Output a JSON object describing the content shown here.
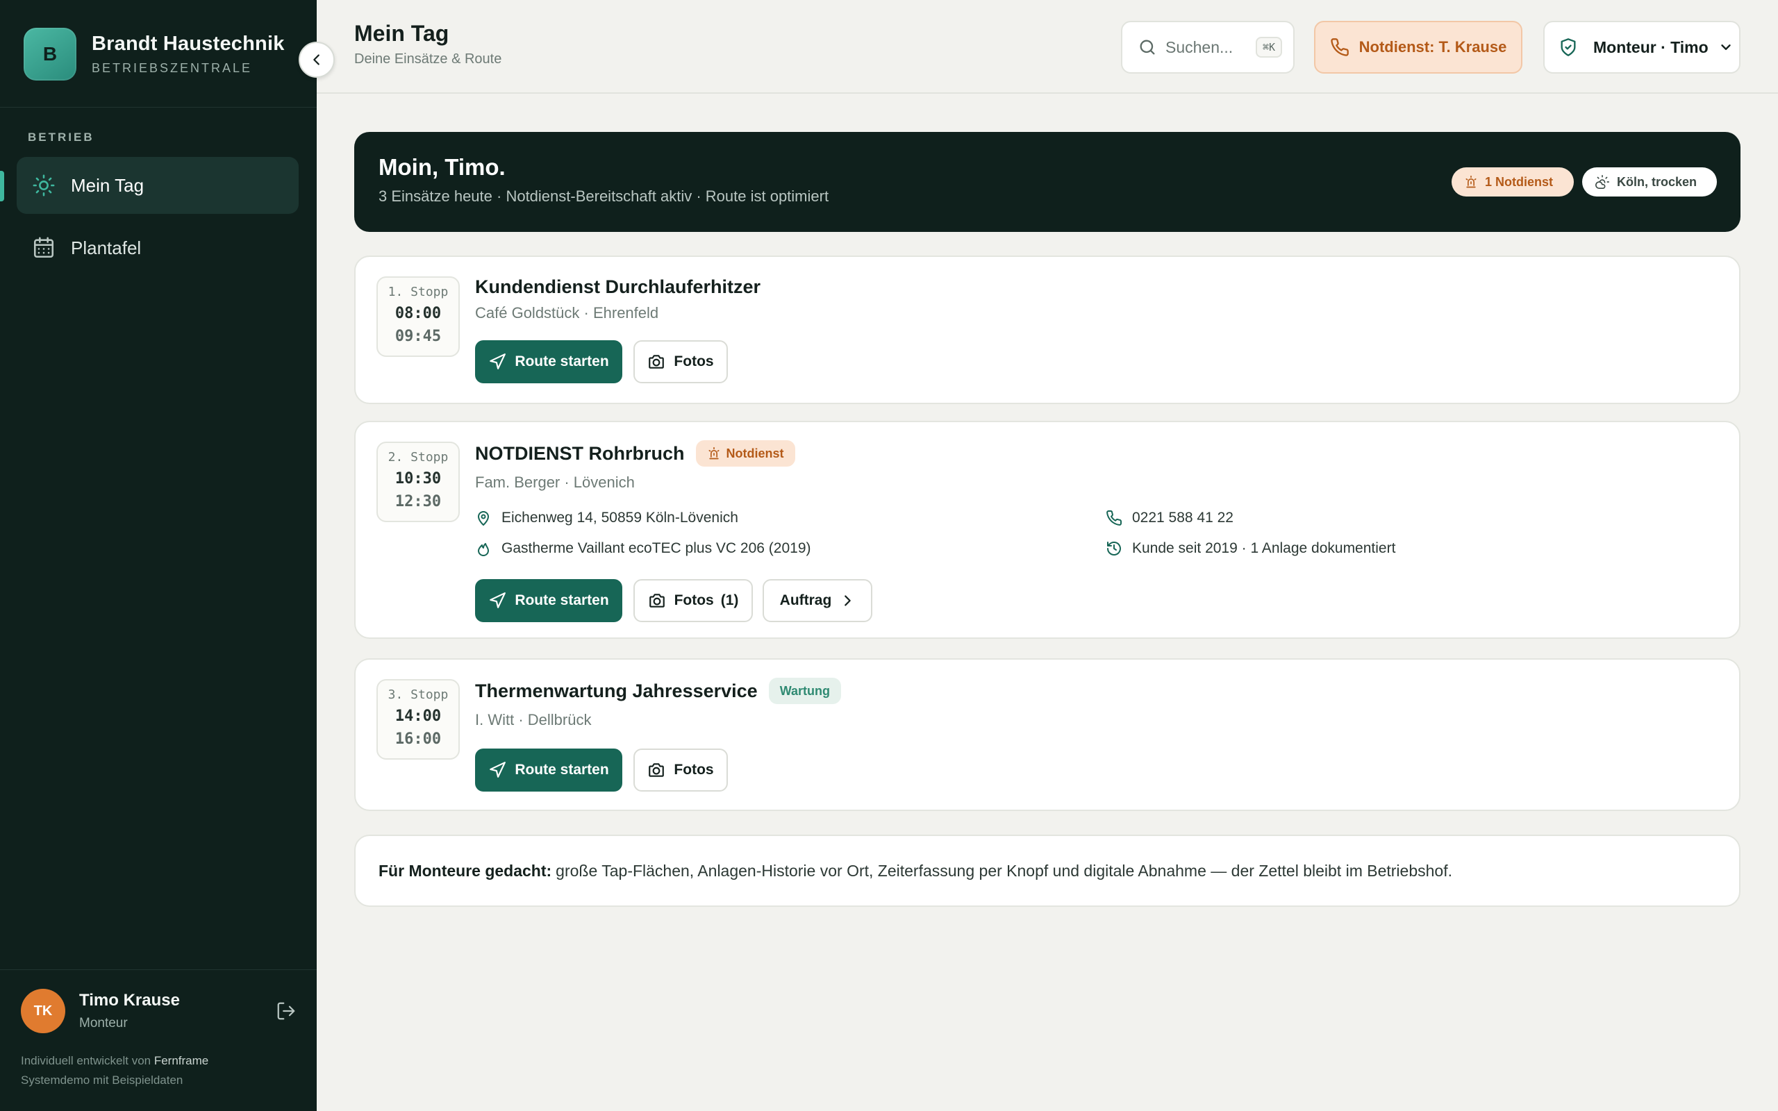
{
  "sidebar": {
    "brand_initial": "B",
    "brand_name": "Brandt Haustechnik",
    "brand_sub": "BETRIEBSZENTRALE",
    "section_label": "BETRIEB",
    "items": [
      {
        "label": "Mein Tag",
        "icon": "sun-icon",
        "active": true
      },
      {
        "label": "Plantafel",
        "icon": "calendar-icon",
        "active": false
      }
    ],
    "user": {
      "initials": "TK",
      "name": "Timo Krause",
      "role": "Monteur"
    },
    "credits_line1_prefix": "Individuell entwickelt von",
    "credits_line1_brand": "Fernframe",
    "credits_line2": "Systemdemo mit Beispieldaten"
  },
  "header": {
    "title": "Mein Tag",
    "subtitle": "Deine Einsätze & Route",
    "search_placeholder": "Suchen...",
    "search_shortcut": "⌘K",
    "notdienst_label": "Notdienst: T. Krause",
    "role_label": "Monteur · Timo"
  },
  "welcome": {
    "title": "Moin, Timo.",
    "subtitle": "3 Einsätze heute · Notdienst-Bereitschaft aktiv · Route ist optimiert",
    "pill_notdienst": "1 Notdienst",
    "pill_weather": "Köln, trocken"
  },
  "stops": [
    {
      "stop": "1. Stopp",
      "start": "08:00",
      "end": "09:45",
      "title": "Kundendienst Durchlauferhitzer",
      "sub": "Café Goldstück · Ehrenfeld",
      "route_label": "Route starten",
      "photos_label": "Fotos"
    },
    {
      "stop": "2. Stopp",
      "start": "10:30",
      "end": "12:30",
      "title": "NOTDIENST Rohrbruch",
      "badge": "Notdienst",
      "sub": "Fam. Berger · Lövenich",
      "address": "Eichenweg 14, 50859 Köln-Lövenich",
      "device": "Gastherme Vaillant ecoTEC plus VC 206 (2019)",
      "phone": "0221 588 41 22",
      "history": "Kunde seit 2019 · 1 Anlage dokumentiert",
      "route_label": "Route starten",
      "photos_label": "Fotos",
      "photos_count": "(1)",
      "auftrag_label": "Auftrag"
    },
    {
      "stop": "3. Stopp",
      "start": "14:00",
      "end": "16:00",
      "title": "Thermenwartung Jahresservice",
      "badge": "Wartung",
      "sub": "I. Witt · Dellbrück",
      "route_label": "Route starten",
      "photos_label": "Fotos"
    }
  ],
  "note": {
    "bold": "Für Monteure gedacht:",
    "text": "große Tap-Flächen, Anlagen-Historie vor Ort, Zeiterfassung per Knopf und digitale Abnahme — der Zettel bleibt im Betriebshof."
  },
  "colors": {
    "sidebar_bg": "#0f201c",
    "accent": "#176656",
    "brand_teal": "#3fb89f",
    "notdienst_bg": "#fbe4d3",
    "notdienst_text": "#b45a18",
    "avatar": "#e07b2f"
  }
}
